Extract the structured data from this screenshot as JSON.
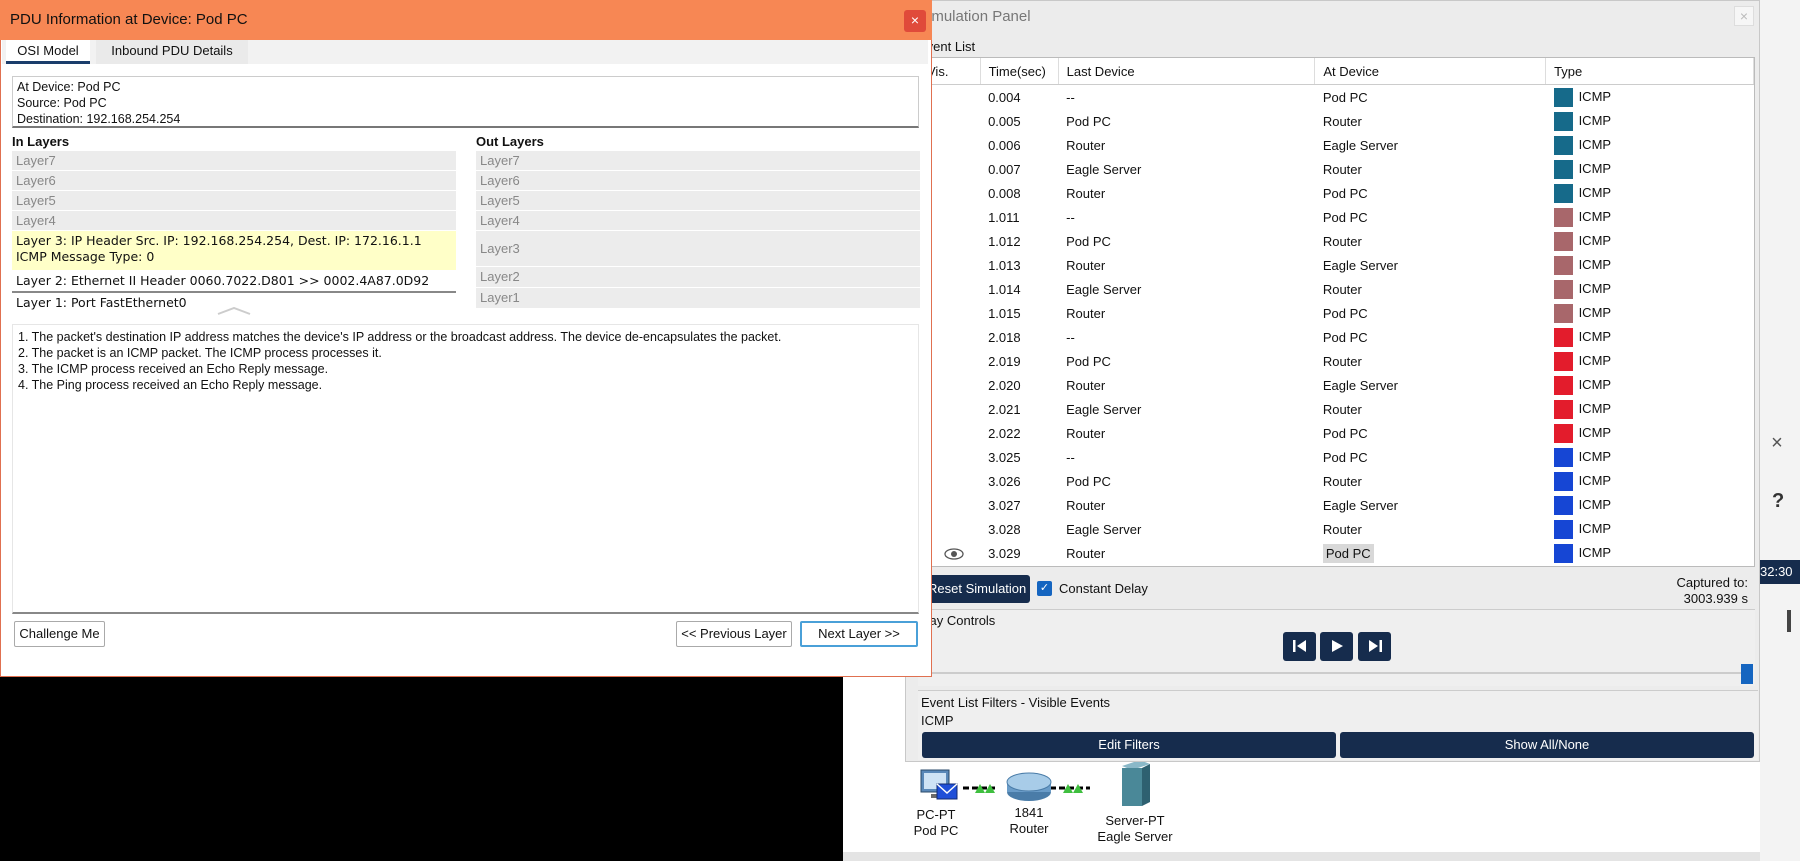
{
  "pdu": {
    "title": "PDU Information at Device: Pod PC",
    "close": "×",
    "tabs": [
      "OSI Model",
      "Inbound PDU Details"
    ],
    "info": {
      "at_device": "At Device: Pod PC",
      "source": "Source: Pod PC",
      "destination": "Destination: 192.168.254.254"
    },
    "in_layers_header": "In Layers",
    "out_layers_header": "Out Layers",
    "in_layers": [
      "Layer7",
      "Layer6",
      "Layer5",
      "Layer4",
      "Layer 3: IP Header Src. IP: 192.168.254.254, Dest. IP: 172.16.1.1 ICMP Message Type: 0",
      "Layer 2: Ethernet II Header 0060.7022.D801 >> 0002.4A87.0D92",
      "Layer 1: Port FastEthernet0"
    ],
    "out_layers": [
      "Layer7",
      "Layer6",
      "Layer5",
      "Layer4",
      "Layer3",
      "Layer2",
      "Layer1"
    ],
    "description": [
      "1. The packet's destination IP address matches the device's IP address or the broadcast address. The device de-encapsulates the packet.",
      "2. The packet is an ICMP packet. The ICMP process processes it.",
      "3. The ICMP process received an Echo Reply message.",
      "4. The Ping process received an Echo Reply message."
    ],
    "buttons": {
      "challenge": "Challenge Me",
      "previous": "<< Previous Layer",
      "next": "Next Layer >>"
    }
  },
  "sim": {
    "title": "Simulation Panel",
    "close": "×",
    "event_list_label": "Event List",
    "columns": [
      "Vis.",
      "Time(sec)",
      "Last Device",
      "At Device",
      "Type"
    ],
    "colors": {
      "teal": "#166a8a",
      "rose": "#a8676b",
      "red": "#e31c2c",
      "blue": "#1646d4"
    },
    "events": [
      {
        "time": "0.004",
        "last": "--",
        "at": "Pod PC",
        "type": "ICMP",
        "color": "#166a8a"
      },
      {
        "time": "0.005",
        "last": "Pod PC",
        "at": "Router",
        "type": "ICMP",
        "color": "#166a8a"
      },
      {
        "time": "0.006",
        "last": "Router",
        "at": "Eagle Server",
        "type": "ICMP",
        "color": "#166a8a"
      },
      {
        "time": "0.007",
        "last": "Eagle Server",
        "at": "Router",
        "type": "ICMP",
        "color": "#166a8a"
      },
      {
        "time": "0.008",
        "last": "Router",
        "at": "Pod PC",
        "type": "ICMP",
        "color": "#166a8a"
      },
      {
        "time": "1.011",
        "last": "--",
        "at": "Pod PC",
        "type": "ICMP",
        "color": "#a8676b"
      },
      {
        "time": "1.012",
        "last": "Pod PC",
        "at": "Router",
        "type": "ICMP",
        "color": "#a8676b"
      },
      {
        "time": "1.013",
        "last": "Router",
        "at": "Eagle Server",
        "type": "ICMP",
        "color": "#a8676b"
      },
      {
        "time": "1.014",
        "last": "Eagle Server",
        "at": "Router",
        "type": "ICMP",
        "color": "#a8676b"
      },
      {
        "time": "1.015",
        "last": "Router",
        "at": "Pod PC",
        "type": "ICMP",
        "color": "#a8676b"
      },
      {
        "time": "2.018",
        "last": "--",
        "at": "Pod PC",
        "type": "ICMP",
        "color": "#e31c2c"
      },
      {
        "time": "2.019",
        "last": "Pod PC",
        "at": "Router",
        "type": "ICMP",
        "color": "#e31c2c"
      },
      {
        "time": "2.020",
        "last": "Router",
        "at": "Eagle Server",
        "type": "ICMP",
        "color": "#e31c2c"
      },
      {
        "time": "2.021",
        "last": "Eagle Server",
        "at": "Router",
        "type": "ICMP",
        "color": "#e31c2c"
      },
      {
        "time": "2.022",
        "last": "Router",
        "at": "Pod PC",
        "type": "ICMP",
        "color": "#e31c2c"
      },
      {
        "time": "3.025",
        "last": "--",
        "at": "Pod PC",
        "type": "ICMP",
        "color": "#1646d4"
      },
      {
        "time": "3.026",
        "last": "Pod PC",
        "at": "Router",
        "type": "ICMP",
        "color": "#1646d4"
      },
      {
        "time": "3.027",
        "last": "Router",
        "at": "Eagle Server",
        "type": "ICMP",
        "color": "#1646d4"
      },
      {
        "time": "3.028",
        "last": "Eagle Server",
        "at": "Router",
        "type": "ICMP",
        "color": "#1646d4"
      },
      {
        "time": "3.029",
        "last": "Router",
        "at": "Pod PC",
        "type": "ICMP",
        "color": "#1646d4",
        "visible_icon": "eye-icon",
        "current": true
      }
    ],
    "reset": "Reset Simulation",
    "constant_delay": "Constant Delay",
    "constant_delay_checked": true,
    "captured_to_label": "Captured to:",
    "captured_to_value": "3003.939 s",
    "play_controls_label": "Play Controls",
    "play_speed": 1.0,
    "filters_label": "Event List Filters - Visible Events",
    "filters_value": "ICMP",
    "edit_filters": "Edit Filters",
    "show_all": "Show All/None"
  },
  "topology": {
    "pc": {
      "type": "PC-PT",
      "name": "Pod PC"
    },
    "router": {
      "type": "1841",
      "name": "Router"
    },
    "server": {
      "type": "Server-PT",
      "name": "Eagle Server"
    }
  },
  "side": {
    "close": "×",
    "help": "?",
    "clock": "32:30"
  }
}
